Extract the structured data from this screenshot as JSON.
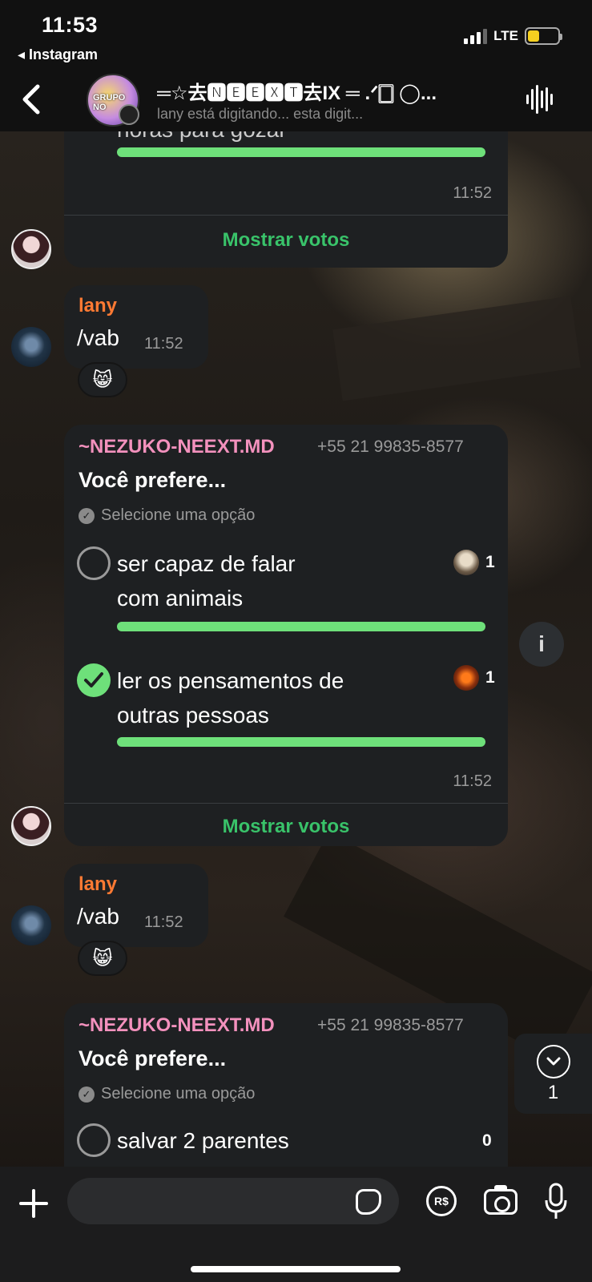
{
  "status_bar": {
    "time": "11:53",
    "back_app": "◂ Instagram",
    "network": "LTE"
  },
  "header": {
    "group_title": "═☆去🅽🅴🅴🆇🆃去IX ═ .ᐟ🀆 ◯...",
    "typing_status": "lany está digitando...  esta digit...",
    "avatar_text": "GRUPO NO"
  },
  "messages": {
    "poll1_partial": {
      "option_text": "horas para gozar",
      "time": "11:52",
      "show_votes": "Mostrar votos"
    },
    "lany_msg1": {
      "sender": "lany",
      "text": "/vab",
      "time": "11:52",
      "reaction": "😸"
    },
    "poll2": {
      "sender": "~NEZUKO-NEEXT.MD",
      "phone": "+55 21 99835-8577",
      "title": "Você prefere...",
      "hint": "Selecione uma opção",
      "options": [
        {
          "line1": "ser capaz de falar",
          "line2": "com animais",
          "votes": "1",
          "fill": 1.0,
          "checked": false
        },
        {
          "line1": "ler os pensamentos de",
          "line2": "outras pessoas",
          "votes": "1",
          "fill": 1.0,
          "checked": true
        }
      ],
      "time": "11:52",
      "show_votes": "Mostrar votos"
    },
    "lany_msg2": {
      "sender": "lany",
      "text": "/vab",
      "time": "11:52",
      "reaction": "😸"
    },
    "poll3": {
      "sender": "~NEZUKO-NEEXT.MD",
      "phone": "+55 21 99835-8577",
      "title": "Você prefere...",
      "hint": "Selecione uma opção",
      "options": [
        {
          "line1": "salvar 2 parentes",
          "votes": "0",
          "checked": false
        }
      ]
    }
  },
  "scroll_down": {
    "unread_count": "1"
  },
  "input": {
    "placeholder": "",
    "pix_label": "R$"
  },
  "colors": {
    "accent_green": "#6ee07a",
    "show_votes_green": "#39c36a",
    "lany_name": "#ff7a33",
    "bot_name": "#f391bd",
    "bubble": "#1e2022"
  },
  "icons": [
    "back-chevron-icon",
    "voice-wave-icon",
    "info-icon",
    "chevron-down-icon",
    "plus-icon",
    "sticker-icon",
    "pix-icon",
    "camera-icon",
    "microphone-icon"
  ]
}
